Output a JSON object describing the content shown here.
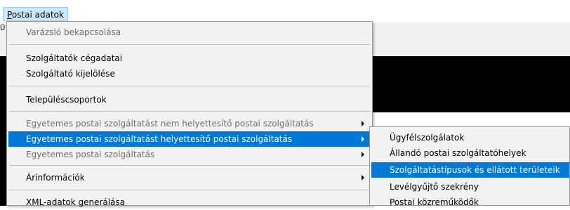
{
  "menubar": {
    "item_mnemonic": "P",
    "item_rest": "ostai adatok"
  },
  "app": {
    "stub_text": "Ü"
  },
  "main_menu": {
    "items": [
      {
        "label": "Varázsló bekapcsolása",
        "disabled": true
      },
      {
        "label": "Szolgáltatók cégadatai",
        "disabled": false
      },
      {
        "label": "Szolgáltató kijelölése",
        "disabled": false
      },
      {
        "label": "Településcsoportok",
        "disabled": false
      },
      {
        "label": "Egyetemes postai szolgáltatást nem helyettesítő postai szolgáltatás",
        "disabled": true,
        "submenu": true
      },
      {
        "label": "Egyetemes postai szolgáltatást helyettesítő postai szolgáltatás",
        "disabled": false,
        "submenu": true,
        "highlighted": true
      },
      {
        "label": "Egyetemes postai szolgáltatás",
        "disabled": true,
        "submenu": true
      },
      {
        "label": "Árinformációk",
        "disabled": false,
        "submenu": true
      },
      {
        "label": "XML-adatok generálása",
        "disabled": false
      }
    ]
  },
  "sub_menu": {
    "items": [
      {
        "label": "Ügyfélszolgálatok"
      },
      {
        "label": "Állandó postai szolgáltatóhelyek"
      },
      {
        "label": "Szolgáltatástípusok és ellátott területeik",
        "highlighted": true
      },
      {
        "label": "Levélgyűjtő szekrény"
      },
      {
        "label": "Postai közreműködők"
      }
    ]
  },
  "colors": {
    "highlight": "#0078d7",
    "menu_bg": "#f2f2f2",
    "disabled_text": "#6d6d6d",
    "menubar_hover": "#cce8ff"
  }
}
